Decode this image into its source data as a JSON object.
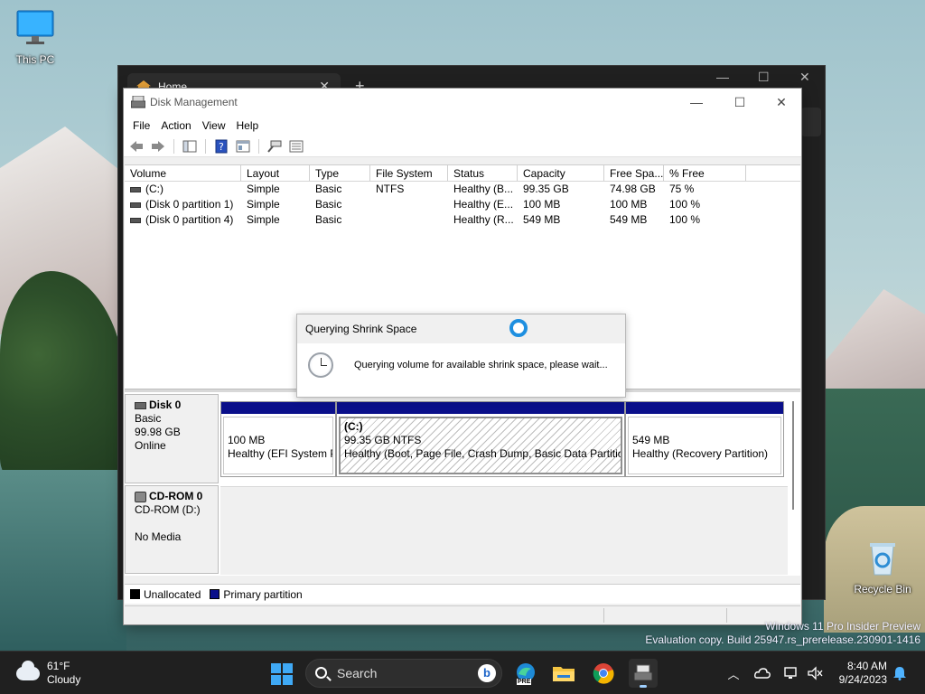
{
  "desktop": {
    "this_pc_label": "This PC",
    "recycle_bin_label": "Recycle Bin"
  },
  "background_window": {
    "tab_label": "Home",
    "new_tab": "+",
    "tab_close": "✕",
    "min": "—",
    "max": "☐",
    "close": "✕"
  },
  "disk_management": {
    "title": "Disk Management",
    "minimize": "—",
    "maximize": "☐",
    "close": "✕",
    "menu": [
      "File",
      "Action",
      "View",
      "Help"
    ],
    "columns": [
      "Volume",
      "Layout",
      "Type",
      "File System",
      "Status",
      "Capacity",
      "Free Spa...",
      "% Free"
    ],
    "volumes": [
      [
        "(C:)",
        "Simple",
        "Basic",
        "NTFS",
        "Healthy (B...",
        "99.35 GB",
        "74.98 GB",
        "75 %"
      ],
      [
        "(Disk 0 partition 1)",
        "Simple",
        "Basic",
        "",
        "Healthy (E...",
        "100 MB",
        "100 MB",
        "100 %"
      ],
      [
        "(Disk 0 partition 4)",
        "Simple",
        "Basic",
        "",
        "Healthy (R...",
        "549 MB",
        "549 MB",
        "100 %"
      ]
    ],
    "disk0": {
      "name": "Disk 0",
      "type": "Basic",
      "size": "99.98 GB",
      "state": "Online",
      "partitions": [
        {
          "label": "",
          "size": "100 MB",
          "status": "Healthy (EFI System P"
        },
        {
          "label": "(C:)",
          "size": "99.35 GB NTFS",
          "status": "Healthy (Boot, Page File, Crash Dump, Basic Data Partition)"
        },
        {
          "label": "",
          "size": "549 MB",
          "status": "Healthy (Recovery Partition)"
        }
      ]
    },
    "cdrom0": {
      "name": "CD-ROM 0",
      "drive": "CD-ROM (D:)",
      "media": "No Media"
    },
    "legend": {
      "unallocated": "Unallocated",
      "primary": "Primary partition",
      "unallocated_color": "#000000",
      "primary_color": "#0a0f8a"
    }
  },
  "dialog": {
    "title": "Querying Shrink Space",
    "message": "Querying volume for available shrink space, please wait..."
  },
  "watermark": {
    "line1": "Windows 11 Pro Insider Preview",
    "line2": "Evaluation copy. Build 25947.rs_prerelease.230901-1416"
  },
  "taskbar": {
    "temperature": "61°F",
    "condition": "Cloudy",
    "search_placeholder": "Search",
    "bing_glyph": "b",
    "time": "8:40 AM",
    "date": "9/24/2023",
    "chevron": "︿",
    "pre_badge": "PRE"
  }
}
